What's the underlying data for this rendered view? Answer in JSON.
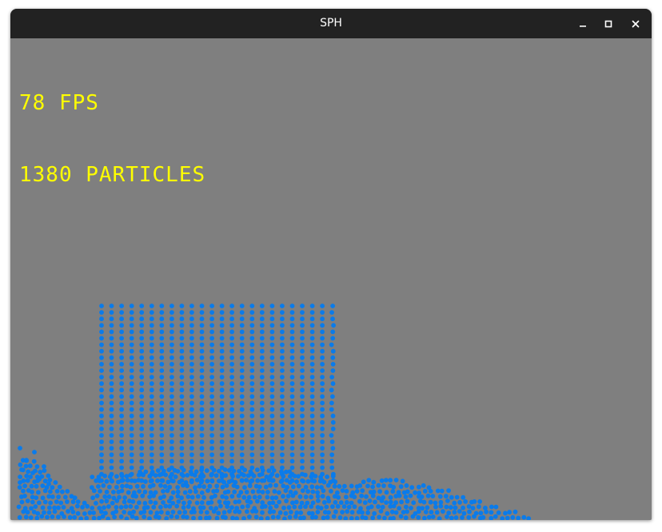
{
  "window": {
    "title": "SPH"
  },
  "hud": {
    "fps": "78 FPS",
    "particles": "1380 PARTICLES"
  },
  "colors": {
    "background": "#7f7f7f",
    "particle": "#0a7bea",
    "hud_text": "#ffff00",
    "titlebar": "#222222"
  },
  "icons": [
    "minimize-icon",
    "maximize-icon",
    "close-icon"
  ]
}
